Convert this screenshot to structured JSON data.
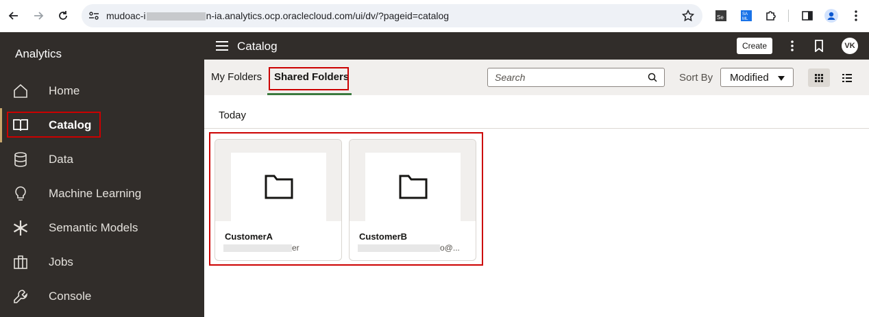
{
  "browser": {
    "url_prefix": "mudoac-i",
    "url_suffix": "n-ia.analytics.ocp.oraclecloud.com/ui/dv/?pageid=catalog"
  },
  "sidebar": {
    "title": "Analytics",
    "items": [
      {
        "label": "Home",
        "icon": "home-icon"
      },
      {
        "label": "Catalog",
        "icon": "book-icon",
        "active": true
      },
      {
        "label": "Data",
        "icon": "database-icon"
      },
      {
        "label": "Machine Learning",
        "icon": "lightbulb-icon"
      },
      {
        "label": "Semantic Models",
        "icon": "snowflake-icon"
      },
      {
        "label": "Jobs",
        "icon": "jobs-icon"
      },
      {
        "label": "Console",
        "icon": "wrench-icon"
      }
    ]
  },
  "header": {
    "title": "Catalog",
    "create_label": "Create",
    "avatar_initials": "VK"
  },
  "toolbar": {
    "tabs": [
      {
        "label": "My Folders"
      },
      {
        "label": "Shared Folders",
        "selected": true
      }
    ],
    "search_placeholder": "Search",
    "sort_label": "Sort By",
    "sort_value": "Modified"
  },
  "content": {
    "section_title": "Today",
    "folders": [
      {
        "name": "CustomerA",
        "owner_visible": "er"
      },
      {
        "name": "CustomerB",
        "owner_visible": "o@..."
      }
    ]
  },
  "colors": {
    "sidebar_bg": "#312d2a",
    "highlight": "#cc0000",
    "tab_underline": "#3a7a3e"
  }
}
